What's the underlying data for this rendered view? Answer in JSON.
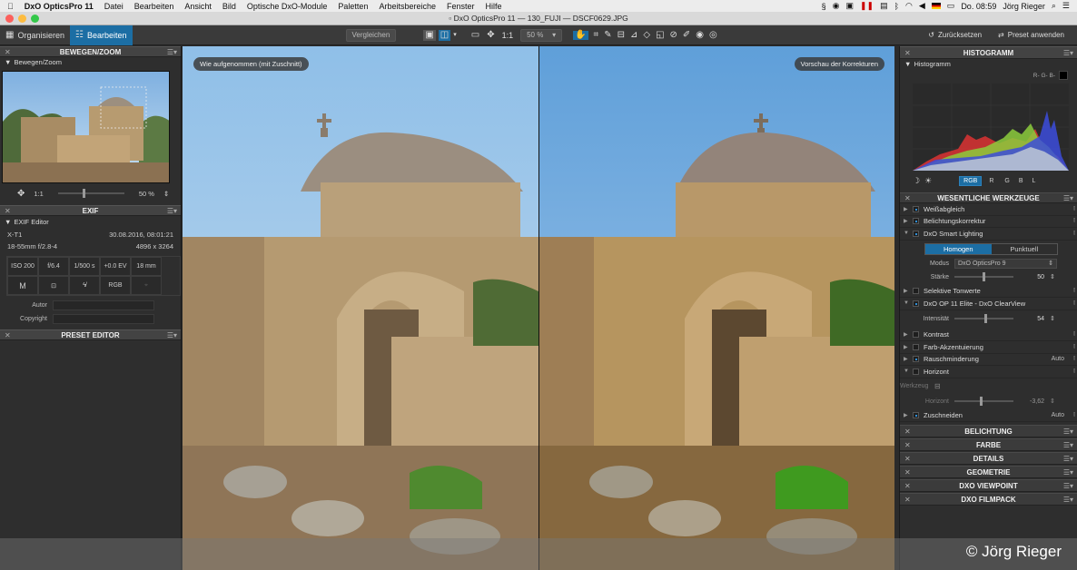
{
  "menubar": {
    "app_name": "DxO OpticsPro 11",
    "items": [
      "Datei",
      "Bearbeiten",
      "Ansicht",
      "Bild",
      "Optische DxO-Module",
      "Paletten",
      "Arbeitsbereiche",
      "Fenster",
      "Hilfe"
    ],
    "clock": "Do. 08:59",
    "user": "Jörg Rieger"
  },
  "window": {
    "title": "DxO OpticsPro 11 — 130_FUJI — DSCF0629.JPG"
  },
  "toolbar": {
    "tab_organize": "Organisieren",
    "tab_edit": "Bearbeiten",
    "compare": "Vergleichen",
    "zoom_1to1": "1:1",
    "zoom_value": "50 %",
    "reset": "Zurücksetzen",
    "apply_preset": "Preset anwenden"
  },
  "left": {
    "move_zoom_title": "BEWEGEN/ZOOM",
    "move_zoom_sub": "Bewegen/Zoom",
    "nav_1to1": "1:1",
    "nav_zoom": "50 %",
    "exif_title": "EXIF",
    "exif_sub": "EXIF Editor",
    "camera": "X-T1",
    "datetime": "30.08.2016, 08:01:21",
    "lens": "18-55mm f/2.8-4",
    "dimensions": "4896 x 3264",
    "grid_row1": [
      "ISO 200",
      "f/6.4",
      "1/500 s",
      "+0.0 EV",
      "18 mm"
    ],
    "grid_row2": [
      "M",
      "",
      "",
      "RGB",
      ""
    ],
    "author_label": "Autor",
    "copyright_label": "Copyright",
    "preset_editor_title": "PRESET EDITOR"
  },
  "viewer": {
    "label_left": "Wie aufgenommen (mit Zuschnitt)",
    "label_right": "Vorschau der Korrekturen"
  },
  "right": {
    "histogram_title": "HISTOGRAMM",
    "histogram_sub": "Histogramm",
    "clip_label": "R- G- B-",
    "channels": [
      "RGB",
      "R",
      "G",
      "B",
      "L"
    ],
    "essential_title": "WESENTLICHE WERKZEUGE",
    "tools_top": [
      {
        "label": "Weißabgleich",
        "open": false
      },
      {
        "label": "Belichtungskorrektur",
        "open": false
      },
      {
        "label": "DxO Smart Lighting",
        "open": true
      }
    ],
    "smart_lighting": {
      "mode_a": "Homogen",
      "mode_b": "Punktuell",
      "modus_label": "Modus",
      "modus_value": "DxO OpticsPro 9",
      "strength_label": "Stärke",
      "strength_value": "50",
      "strength_level": 0.5
    },
    "tools_mid": [
      {
        "label": "Selektive Tonwerte",
        "open": false
      },
      {
        "label": "DxO OP 11 Elite - DxO ClearView",
        "open": true
      }
    ],
    "clearview": {
      "intensity_label": "Intensität",
      "intensity_value": "54",
      "intensity_level": 0.54
    },
    "tools_bottom": [
      {
        "label": "Kontrast",
        "open": false,
        "right": ""
      },
      {
        "label": "Farb-Akzentuierung",
        "open": false,
        "right": ""
      },
      {
        "label": "Rauschminderung",
        "open": false,
        "right": "Auto"
      },
      {
        "label": "Horizont",
        "open": true,
        "right": ""
      }
    ],
    "horizon": {
      "tool_label": "Werkzeug",
      "horizon_label": "Horizont",
      "horizon_value": "-3,62",
      "horizon_level": 0.45
    },
    "crop": {
      "label": "Zuschneiden",
      "right": "Auto"
    },
    "sections": [
      "BELICHTUNG",
      "FARBE",
      "DETAILS",
      "GEOMETRIE",
      "DXO VIEWPOINT",
      "DXO FILMPACK"
    ]
  },
  "credit": "© Jörg Rieger",
  "colors": {
    "accent": "#1c6ea4",
    "sky": "#8ec0e8",
    "stone": "#c2a47a"
  }
}
